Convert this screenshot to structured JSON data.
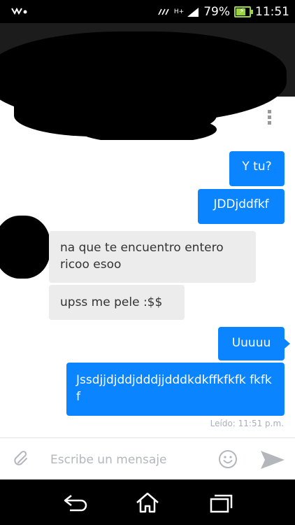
{
  "status_bar": {
    "battery": "79%",
    "time": "11:51",
    "network": "H+",
    "icons": [
      "walkman-icon",
      "vibrate-icon",
      "signal-icon",
      "battery-charging-icon"
    ],
    "battery_level": 0.79
  },
  "header": {
    "icons": [
      "overflow-menu-icon"
    ]
  },
  "conversation": {
    "messages": [
      {
        "direction": "outgoing",
        "text": "Y tu?"
      },
      {
        "direction": "outgoing",
        "text": "JDDjddfkf"
      },
      {
        "direction": "incoming",
        "text": "na que te encuentro entero ricoo esoo"
      },
      {
        "direction": "incoming",
        "text": "upss me pele :$$"
      },
      {
        "direction": "outgoing",
        "text": "Uuuuu"
      },
      {
        "direction": "outgoing",
        "text": "Jssdjjdjddjdddjjdddkdkffkfkfk fkfkf"
      }
    ],
    "read_receipt": "Leído: 11:51 p.m."
  },
  "composer": {
    "placeholder": "Escribe un mensaje",
    "icons": [
      "paperclip-icon",
      "emoji-icon",
      "send-icon"
    ]
  },
  "navigation": {
    "icons": [
      "back-icon",
      "home-icon",
      "recent-apps-icon"
    ]
  },
  "colors": {
    "outgoing_bubble": "#0a84ff",
    "incoming_bubble": "#ececec",
    "read_receipt": "#a7b1bd"
  }
}
